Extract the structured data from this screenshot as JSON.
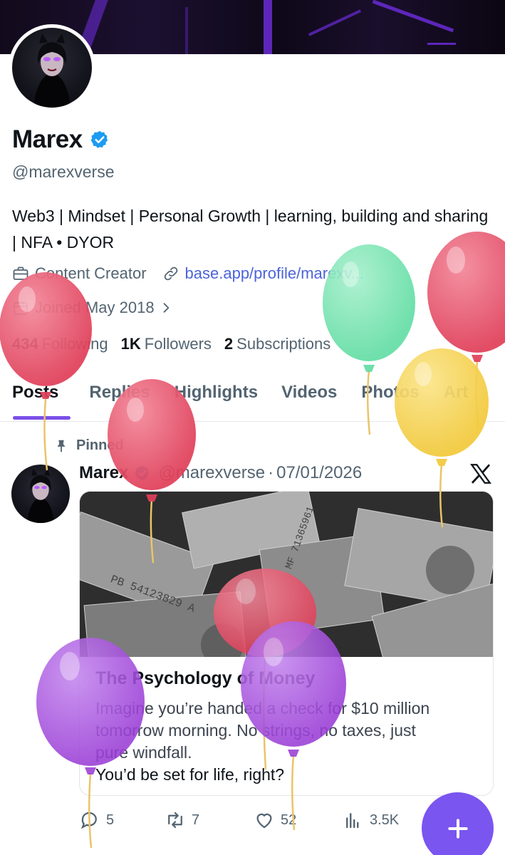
{
  "profile": {
    "display_name": "Marex",
    "handle": "@marexverse",
    "bio": "Web3 | Mindset | Personal Growth | learning, building and sharing | NFA • DYOR",
    "category": "Content Creator",
    "link": "base.app/profile/marexv...",
    "joined": "Joined May 2018",
    "following_count": "434",
    "following_label": "Following",
    "followers_count": "1K",
    "followers_label": "Followers",
    "subscriptions_count": "2",
    "subscriptions_label": "Subscriptions"
  },
  "tabs": [
    {
      "label": "Posts",
      "active": true
    },
    {
      "label": "Replies"
    },
    {
      "label": "Highlights"
    },
    {
      "label": "Videos"
    },
    {
      "label": "Photos"
    },
    {
      "label": "Art"
    }
  ],
  "post": {
    "pinned_label": "Pinned",
    "author": "Marex",
    "handle": "@marexverse",
    "separator": "·",
    "date": "07/01/2026",
    "card": {
      "title": "The Psychology of Money",
      "line1": "Imagine you’re handed a check for $10 million",
      "line2": "tomorrow morning. No strings, no taxes, just",
      "line3": "pure windfall.",
      "line4": "You’d be set for life, right?"
    },
    "replies": "5",
    "reposts": "7",
    "likes": "52",
    "views": "3.5K"
  },
  "colors": {
    "accent": "#7a4fe8",
    "fab": "#7a55f0",
    "link": "#4c64d9",
    "verified": "#1d9bf0"
  },
  "icons": [
    "verified-badge-icon",
    "briefcase-icon",
    "link-icon",
    "calendar-icon",
    "chevron-right-icon",
    "pin-icon",
    "x-logo-icon",
    "reply-icon",
    "repost-icon",
    "like-icon",
    "views-icon",
    "plus-icon"
  ]
}
